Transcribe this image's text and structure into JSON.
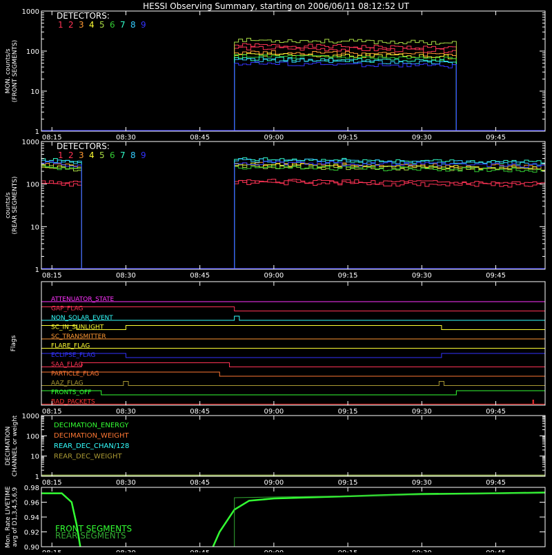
{
  "title": "HESSI Observing Summary, starting on 2006/06/11 08:12:52 UT",
  "x_ticks": [
    "08:15",
    "08:30",
    "08:45",
    "09:00",
    "09:15",
    "09:30",
    "09:45"
  ],
  "colors": {
    "background": "#000000",
    "axes": "#ffffff",
    "det": [
      "#ff3355",
      "#ff3355",
      "#ff9933",
      "#ffff33",
      "#aadd44",
      "#33cc33",
      "#33ffcc",
      "#33ccff",
      "#3333ff"
    ]
  },
  "detectors": {
    "label": "DETECTORS:",
    "numbers": [
      "1",
      "2",
      "3",
      "4",
      "5",
      "6",
      "7",
      "8",
      "9"
    ]
  },
  "chart_data": [
    {
      "type": "line",
      "ylabel": "MON. counts/s\n(FRONT SEGMENTS)",
      "ylog": true,
      "ylim": [
        1,
        1000
      ],
      "y_ticks": [
        "1",
        "10",
        "100",
        "1000"
      ],
      "xlim": [
        "08:12:52",
        "09:55"
      ],
      "series": [
        {
          "name": "1",
          "color": "#ff3355",
          "level": 140,
          "on": [
            [
              "08:52",
              "09:37"
            ]
          ]
        },
        {
          "name": "2",
          "color": "#ff3355",
          "level": 120,
          "on": [
            [
              "08:52",
              "09:37"
            ]
          ]
        },
        {
          "name": "3",
          "color": "#ff9933",
          "level": 95,
          "on": [
            [
              "08:52",
              "09:37"
            ]
          ]
        },
        {
          "name": "4",
          "color": "#ffff33",
          "level": 85,
          "on": [
            [
              "08:52",
              "09:37"
            ]
          ]
        },
        {
          "name": "5",
          "color": "#aadd44",
          "level": 190,
          "on": [
            [
              "08:52",
              "09:37"
            ]
          ]
        },
        {
          "name": "6",
          "color": "#33cc33",
          "level": 75,
          "on": [
            [
              "08:52",
              "09:37"
            ]
          ]
        },
        {
          "name": "7",
          "color": "#33ffcc",
          "level": 65,
          "on": [
            [
              "08:52",
              "09:37"
            ]
          ]
        },
        {
          "name": "8",
          "color": "#33ccff",
          "level": 60,
          "on": [
            [
              "08:52",
              "09:37"
            ]
          ]
        },
        {
          "name": "9",
          "color": "#3333ff",
          "level": 50,
          "on": [
            [
              "08:52",
              "09:37"
            ]
          ]
        }
      ]
    },
    {
      "type": "line",
      "ylabel": "counts/s\n(REAR SEGMENTS)",
      "ylog": true,
      "ylim": [
        1,
        1000
      ],
      "y_ticks": [
        "1",
        "10",
        "100",
        "1000"
      ],
      "xlim": [
        "08:12:52",
        "09:55"
      ],
      "series": [
        {
          "name": "1",
          "color": "#ff3355",
          "level": 120,
          "on": [
            [
              "08:12:52",
              "08:21"
            ],
            [
              "08:52",
              "09:55"
            ]
          ]
        },
        {
          "name": "2",
          "color": "#ff3355",
          "level": 110,
          "on": [
            [
              "08:12:52",
              "08:21"
            ],
            [
              "08:52",
              "09:55"
            ]
          ]
        },
        {
          "name": "3",
          "color": "#ff9933",
          "level": 300,
          "on": [
            [
              "08:12:52",
              "08:21"
            ],
            [
              "08:52",
              "09:55"
            ]
          ]
        },
        {
          "name": "4",
          "color": "#ffff33",
          "level": 280,
          "on": [
            [
              "08:12:52",
              "08:21"
            ],
            [
              "08:52",
              "09:55"
            ]
          ]
        },
        {
          "name": "5",
          "color": "#aadd44",
          "level": 260,
          "on": [
            [
              "08:12:52",
              "08:21"
            ],
            [
              "08:52",
              "09:55"
            ]
          ]
        },
        {
          "name": "6",
          "color": "#33cc33",
          "level": 250,
          "on": [
            [
              "08:12:52",
              "08:21"
            ],
            [
              "08:52",
              "09:55"
            ]
          ]
        },
        {
          "name": "7",
          "color": "#33ffcc",
          "level": 380,
          "on": [
            [
              "08:12:52",
              "08:21"
            ],
            [
              "08:52",
              "09:55"
            ]
          ]
        },
        {
          "name": "8",
          "color": "#33ccff",
          "level": 360,
          "on": [
            [
              "08:12:52",
              "08:21"
            ],
            [
              "08:52",
              "09:55"
            ]
          ]
        },
        {
          "name": "9",
          "color": "#3333ff",
          "level": 320,
          "on": [
            [
              "08:12:52",
              "08:21"
            ],
            [
              "08:52",
              "09:55"
            ]
          ]
        }
      ]
    },
    {
      "type": "line",
      "ylabel": "Flags",
      "xlim": [
        "08:12:52",
        "09:55"
      ],
      "flags": [
        {
          "name": "ATTENUATOR_STATE",
          "color": "#ff33ff",
          "high": []
        },
        {
          "name": "GAP_FLAG",
          "color": "#ff3355",
          "high": [
            [
              "08:12:52",
              "08:52"
            ]
          ]
        },
        {
          "name": "NON_SOLAR_EVENT",
          "color": "#33ffff",
          "high": [
            [
              "08:52",
              "08:53"
            ]
          ]
        },
        {
          "name": "SC_IN_SUNLIGHT",
          "color": "#ffff33",
          "high": [
            [
              "08:12:52",
              "08:20"
            ],
            [
              "08:30",
              "09:34"
            ]
          ]
        },
        {
          "name": "SC_TRANSMITTER",
          "color": "#ff9933",
          "high": []
        },
        {
          "name": "FLARE_FLAG",
          "color": "#ffff33",
          "high": []
        },
        {
          "name": "ECLIPSE_FLAG",
          "color": "#3333ff",
          "high": [
            [
              "08:12:52",
              "08:30"
            ],
            [
              "09:34",
              "09:55"
            ]
          ]
        },
        {
          "name": "SAA_FLAG",
          "color": "#ff3355",
          "high": [
            [
              "08:21",
              "08:51"
            ]
          ]
        },
        {
          "name": "PARTICLE_FLAG",
          "color": "#ff7733",
          "high": [
            [
              "08:12:52",
              "08:49"
            ]
          ]
        },
        {
          "name": "AAZ_FLAG",
          "color": "#aa9933",
          "high": [
            [
              "08:29:30",
              "08:30:30"
            ],
            [
              "09:33:30",
              "09:34:30"
            ]
          ]
        },
        {
          "name": "FRONTS_OFF",
          "color": "#33ff33",
          "high": [
            [
              "08:12:52",
              "08:25"
            ],
            [
              "09:37",
              "09:55"
            ]
          ]
        },
        {
          "name": "BAD_PACKETS",
          "color": "#ff3333",
          "high": [
            [
              "09:52:30",
              "09:52:40"
            ]
          ]
        }
      ]
    },
    {
      "type": "line",
      "ylabel": "DECIMATION\nCHANNEL or weight",
      "ylog": true,
      "ylim": [
        1,
        1000
      ],
      "y_ticks": [
        "1",
        "10",
        "100",
        "1000"
      ],
      "xlim": [
        "08:12:52",
        "09:55"
      ],
      "series": [
        {
          "name": "DECIMATION_ENERGY",
          "color": "#33ff33",
          "level": 1
        },
        {
          "name": "DECIMATION_WEIGHT",
          "color": "#ff7733",
          "level": 1
        },
        {
          "name": "REAR_DEC_CHAN/128",
          "color": "#33ffff",
          "level": 1
        },
        {
          "name": "REAR_DEC_WEIGHT",
          "color": "#aa9933",
          "level": 1
        }
      ]
    },
    {
      "type": "line",
      "ylabel": "Mon. Rate LIVETIME\navg of D1,3,4,5,6,9",
      "ylim": [
        0.9,
        0.98
      ],
      "y_ticks": [
        "0.90",
        "0.92",
        "0.94",
        "0.96",
        "0.98"
      ],
      "xlim": [
        "08:12:52",
        "09:55"
      ],
      "series": [
        {
          "name": "FRONT SEGMENTS",
          "color": "#33ff33",
          "points": [
            [
              "08:12:52",
              0.972
            ],
            [
              "08:17",
              0.972
            ],
            [
              "08:19",
              0.96
            ],
            [
              "08:20",
              0.93
            ],
            [
              "08:21",
              0.89
            ],
            [
              "08:47",
              0.89
            ],
            [
              "08:49",
              0.92
            ],
            [
              "08:52",
              0.95
            ],
            [
              "08:55",
              0.962
            ],
            [
              "09:00",
              0.965
            ],
            [
              "09:15",
              0.968
            ],
            [
              "09:30",
              0.971
            ],
            [
              "09:45",
              0.972
            ],
            [
              "09:55",
              0.973
            ]
          ]
        },
        {
          "name": "REAR SEGMENTS",
          "color": "#33aa33",
          "points": [
            [
              "08:52",
              0.89
            ],
            [
              "08:52",
              0.966
            ],
            [
              "09:00",
              0.967
            ],
            [
              "09:30",
              0.97
            ],
            [
              "09:55",
              0.972
            ]
          ]
        }
      ]
    }
  ]
}
